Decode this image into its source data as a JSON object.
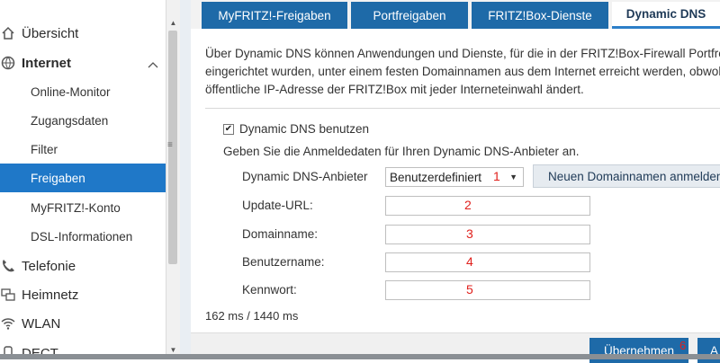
{
  "sidebar": {
    "items": [
      {
        "label": "Übersicht",
        "icon": "home-icon"
      },
      {
        "label": "Internet",
        "icon": "globe-icon"
      },
      {
        "label": "Online-Monitor"
      },
      {
        "label": "Zugangsdaten"
      },
      {
        "label": "Filter"
      },
      {
        "label": "Freigaben"
      },
      {
        "label": "MyFRITZ!-Konto"
      },
      {
        "label": "DSL-Informationen"
      },
      {
        "label": "Telefonie",
        "icon": "phone-icon"
      },
      {
        "label": "Heimnetz",
        "icon": "network-icon"
      },
      {
        "label": "WLAN",
        "icon": "wifi-icon"
      },
      {
        "label": "DECT",
        "icon": "dect-icon"
      }
    ]
  },
  "tabs": [
    {
      "label": "MyFRITZ!-Freigaben"
    },
    {
      "label": "Portfreigaben"
    },
    {
      "label": "FRITZ!Box-Dienste"
    },
    {
      "label": "Dynamic DNS"
    }
  ],
  "intro": {
    "line1": "Über Dynamic DNS können Anwendungen und Dienste, für die in der FRITZ!Box-Firewall Portfreiga",
    "line2": "eingerichtet wurden, unter einem festen Domainnamen aus dem Internet erreicht werden, obwohl",
    "line3": "öffentliche IP-Adresse der FRITZ!Box mit jeder Interneteinwahl ändert."
  },
  "form": {
    "enable_label": "Dynamic DNS benutzen",
    "hint": "Geben Sie die Anmeldedaten für Ihren Dynamic DNS-Anbieter an.",
    "provider_label": "Dynamic DNS-Anbieter",
    "provider_value": "Benutzerdefiniert",
    "register_button": "Neuen Domainnamen anmelden",
    "update_url_label": "Update-URL:",
    "domain_label": "Domainname:",
    "username_label": "Benutzername:",
    "password_label": "Kennwort:",
    "annotations": [
      "1",
      "2",
      "3",
      "4",
      "5",
      "6"
    ]
  },
  "timing": "162 ms / 1440 ms",
  "footer": {
    "apply_label": "Übernehmen",
    "secondary_label": "A"
  },
  "colors": {
    "accent": "#1f78c8",
    "tab_bg": "#1e6aa8",
    "annotation_red": "#e0201c"
  }
}
